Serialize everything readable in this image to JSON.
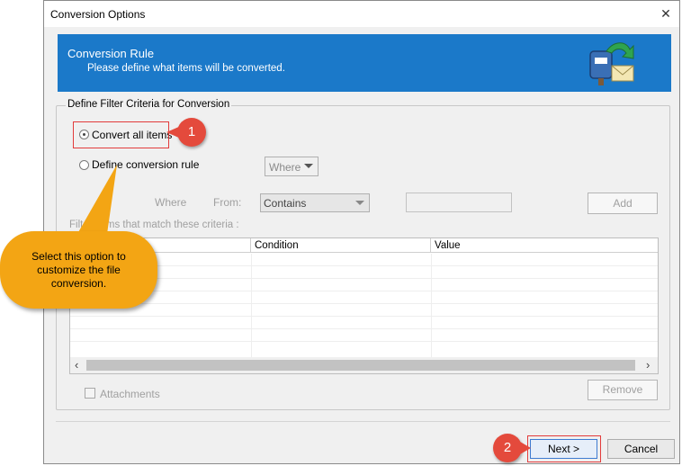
{
  "window": {
    "title": "Conversion Options",
    "close_glyph": "✕"
  },
  "banner": {
    "title": "Conversion Rule",
    "subtitle": "Please define what items will be converted.",
    "icon": "mailbox-convert-icon",
    "color": "#1b79c9"
  },
  "group": {
    "legend": "Define Filter Criteria for Conversion"
  },
  "options": {
    "convert_all": {
      "label": "Convert all items",
      "selected": true
    },
    "define_rule": {
      "label": "Define conversion rule",
      "selected": false
    }
  },
  "rule": {
    "where_dropdown": "Where",
    "where_label": "Where",
    "from_label": "From:",
    "condition_dropdown": "Contains",
    "value_input": "",
    "add_button": "Add",
    "criteria_label": "Filter items that match these criteria :"
  },
  "grid": {
    "columns": [
      "",
      "Condition",
      "Value"
    ],
    "rows": []
  },
  "attachments": {
    "label": "Attachments",
    "checked": false
  },
  "remove_button": "Remove",
  "footer": {
    "next": "Next >",
    "cancel": "Cancel"
  },
  "annotations": {
    "badge1": "1",
    "badge2": "2",
    "callout": "Select this option to customize the file conversion.",
    "accent_red": "#e23b3b",
    "callout_color": "#f3a514"
  }
}
